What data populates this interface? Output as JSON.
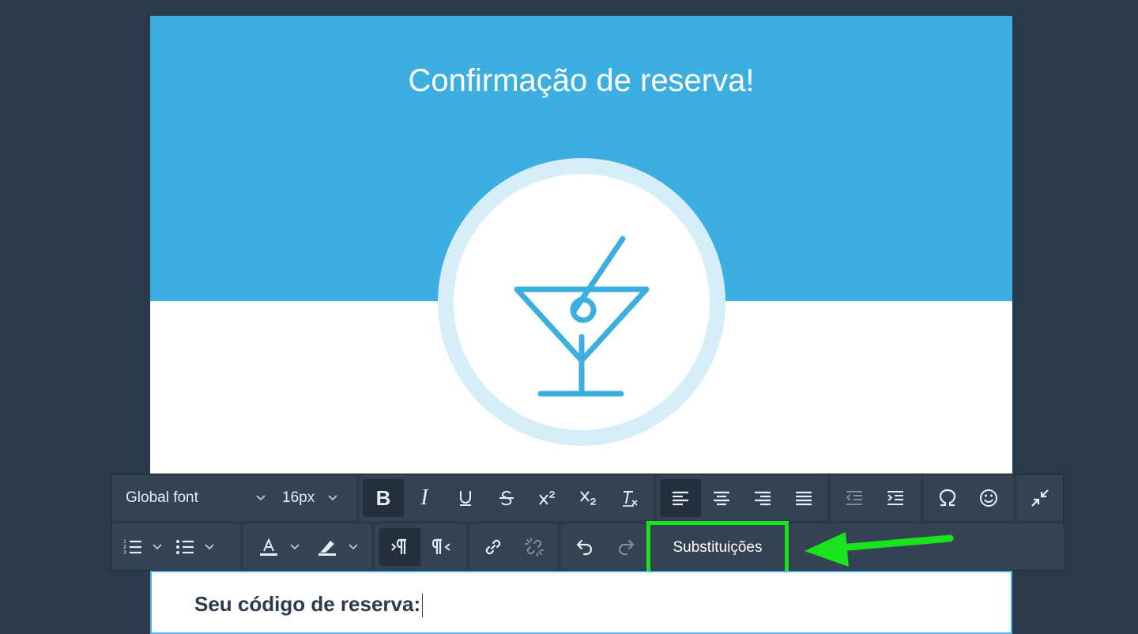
{
  "email": {
    "title": "Confirmação de reserva!",
    "body_text": "Seu código de reserva:"
  },
  "toolbar": {
    "font_family": "Global font",
    "font_size": "16px",
    "substitutions_label": "Substituições",
    "buttons": {
      "bold": "B",
      "italic": "I"
    }
  },
  "colors": {
    "background": "#2b3a4b",
    "hero": "#3caee0",
    "icon": "#3caee0",
    "highlight": "#19e31d"
  }
}
